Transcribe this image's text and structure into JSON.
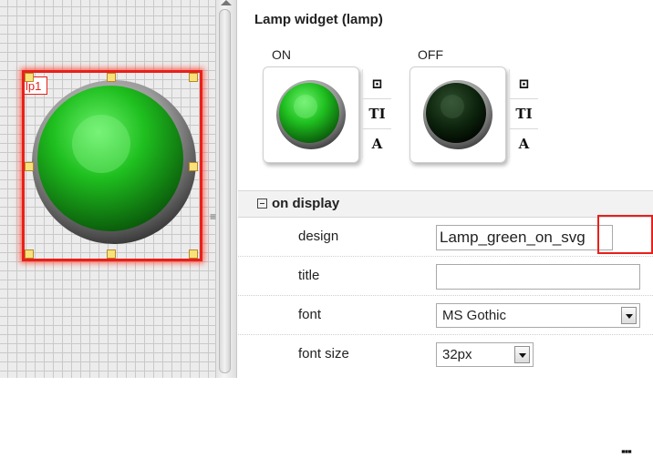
{
  "panel": {
    "title": "Lamp widget (lamp)",
    "state_on": "ON",
    "state_off": "OFF",
    "tools": [
      "crop-icon",
      "text-size-icon",
      "font-icon"
    ],
    "tool_glyphs": [
      "⌑",
      "TI",
      "A"
    ]
  },
  "canvas": {
    "widget_tag": "lp1",
    "lamp_color": "#1fbf1f",
    "selection_color": "#e8201a"
  },
  "group": {
    "title": "on display"
  },
  "properties": {
    "design_label": "design",
    "design_value": "Lamp_green_on_svg",
    "title_label": "title",
    "title_value": "",
    "font_label": "font",
    "font_value": "MS Gothic",
    "font_size_label": "font size",
    "font_size_value": "32px"
  }
}
